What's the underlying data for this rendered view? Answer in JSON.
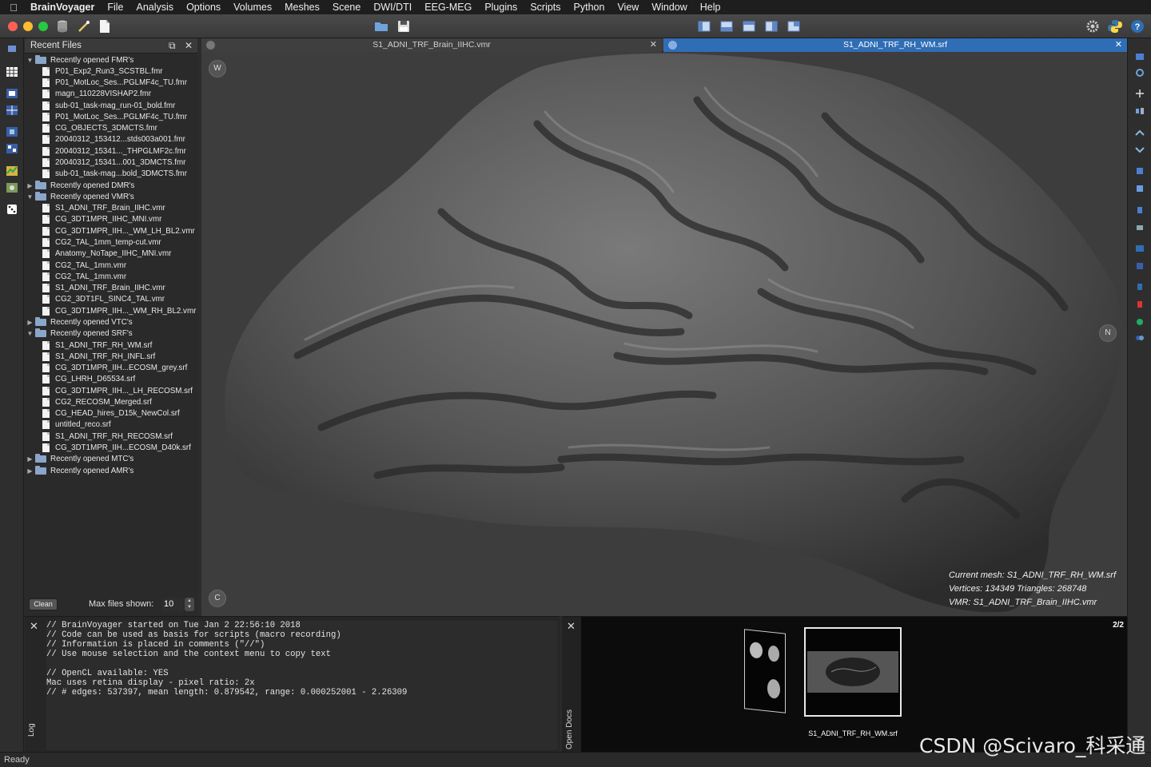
{
  "menubar": {
    "app_name": "BrainVoyager",
    "items": [
      "File",
      "Analysis",
      "Options",
      "Volumes",
      "Meshes",
      "Scene",
      "DWI/DTI",
      "EEG-MEG",
      "Plugins",
      "Scripts",
      "Python",
      "View",
      "Window",
      "Help"
    ]
  },
  "recent_files": {
    "title": "Recent Files",
    "groups": [
      {
        "label": "Recently opened FMR's",
        "expanded": true,
        "files": [
          "P01_Exp2_Run3_SCSTBL.fmr",
          "P01_MotLoc_Ses...PGLMF4c_TU.fmr",
          "magn_110228VISHAP2.fmr",
          "sub-01_task-mag_run-01_bold.fmr",
          "P01_MotLoc_Ses...PGLMF4c_TU.fmr",
          "CG_OBJECTS_3DMCTS.fmr",
          "20040312_153412...stds003a001.fmr",
          "20040312_15341..._THPGLMF2c.fmr",
          "20040312_15341...001_3DMCTS.fmr",
          "sub-01_task-mag...bold_3DMCTS.fmr"
        ]
      },
      {
        "label": "Recently opened DMR's",
        "expanded": false,
        "files": []
      },
      {
        "label": "Recently opened VMR's",
        "expanded": true,
        "files": [
          "S1_ADNI_TRF_Brain_IIHC.vmr",
          "CG_3DT1MPR_IIHC_MNI.vmr",
          "CG_3DT1MPR_IIH..._WM_LH_BL2.vmr",
          "CG2_TAL_1mm_temp-cut.vmr",
          "Anatomy_NoTape_IIHC_MNI.vmr",
          "CG2_TAL_1mm.vmr",
          "CG2_TAL_1mm.vmr",
          "S1_ADNI_TRF_Brain_IIHC.vmr",
          "CG2_3DT1FL_SINC4_TAL.vmr",
          "CG_3DT1MPR_IIH..._WM_RH_BL2.vmr"
        ]
      },
      {
        "label": "Recently opened VTC's",
        "expanded": false,
        "files": []
      },
      {
        "label": "Recently opened SRF's",
        "expanded": true,
        "files": [
          "S1_ADNI_TRF_RH_WM.srf",
          "S1_ADNI_TRF_RH_INFL.srf",
          "CG_3DT1MPR_IIH...ECOSM_grey.srf",
          "CG_LHRH_D65534.srf",
          "CG_3DT1MPR_IIH..._LH_RECOSM.srf",
          "CG2_RECOSM_Merged.srf",
          "CG_HEAD_hires_D15k_NewCol.srf",
          "untitled_reco.srf",
          "S1_ADNI_TRF_RH_RECOSM.srf",
          "CG_3DT1MPR_IIH...ECOSM_D40k.srf"
        ]
      },
      {
        "label": "Recently opened MTC's",
        "expanded": false,
        "files": []
      },
      {
        "label": "Recently opened AMR's",
        "expanded": false,
        "files": []
      }
    ],
    "clean_label": "Clean",
    "max_files_label": "Max files shown:",
    "max_files_value": "10"
  },
  "tabs": [
    {
      "label": "S1_ADNI_TRF_Brain_IIHC.vmr",
      "active": false
    },
    {
      "label": "S1_ADNI_TRF_RH_WM.srf",
      "active": true
    }
  ],
  "viewport": {
    "btn_w": "W",
    "btn_c": "C",
    "btn_n": "N",
    "mesh_info_line1": "Current mesh: S1_ADNI_TRF_RH_WM.srf",
    "mesh_info_line2": "Vertices: 134349  Triangles: 268748",
    "mesh_info_line3": "VMR: S1_ADNI_TRF_Brain_IIHC.vmr"
  },
  "log": {
    "title": "Log",
    "text": "// BrainVoyager started on Tue Jan 2 22:56:10 2018\n// Code can be used as basis for scripts (macro recording)\n// Information is placed in comments (\"//\")\n// Use mouse selection and the context menu to copy text\n\n// OpenCL available: YES\nMac uses retina display - pixel ratio: 2x\n// # edges: 537397, mean length: 0.879542, range: 0.000252001 - 2.26309"
  },
  "open_docs": {
    "title": "Open Docs",
    "page": "2/2",
    "thumb_label": "S1_ADNI_TRF_RH_WM.srf"
  },
  "status": "Ready",
  "watermark": "CSDN @Scivaro_科采通",
  "colors": {
    "active_tab": "#2f6db5",
    "background": "#3d3d3d",
    "mesh": "#5a5a5a"
  }
}
